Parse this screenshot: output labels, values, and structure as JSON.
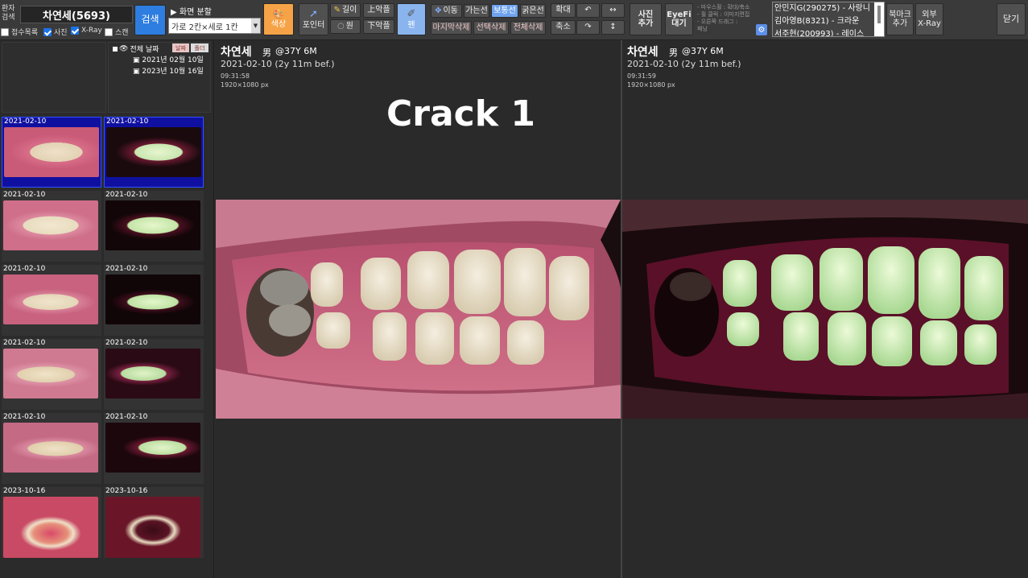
{
  "search": {
    "label": "환자\n검색",
    "patient": "차연세(5693)",
    "button": "검색"
  },
  "checkboxes": [
    {
      "label": "접수목록",
      "checked": false
    },
    {
      "label": "사진",
      "checked": true
    },
    {
      "label": "X-Ray",
      "checked": true
    },
    {
      "label": "스캔",
      "checked": false
    }
  ],
  "split": {
    "title": "▶ 화면 분할",
    "value": "가로 2칸×세로 1칸"
  },
  "toolbar": {
    "color": "색상",
    "pointer": "포인터",
    "length": "길이",
    "circle": "원",
    "upper": "上악플",
    "lower": "下악플",
    "pen": "펜",
    "move": "이동",
    "thin": "가는선",
    "medium": "보통선",
    "thick": "굵은선",
    "del_last": "마지막삭제",
    "del_sel": "선택삭제",
    "del_all": "전체삭제",
    "zoom_in": "확대",
    "zoom_out": "축소",
    "add_photo": "사진\n추가",
    "eyefi": "EyeFi\n대기",
    "hint1": "- 마우스휠 : 확대/축소",
    "hint2": "- 휠 클릭 : 이미지편집",
    "hint3": "- 오른쪽 드래그 :",
    "hint4": "  패닝",
    "bookmark": "북마크\n추가",
    "ext_xray": "외부\nX-Ray",
    "close": "닫기"
  },
  "bookmarks": [
    "안민지G(290275) - 사랑니",
    "김아영B(8321) - 크라운",
    "서주현(200993) - 레이스"
  ],
  "tree": {
    "root": "전체 날짜",
    "tab_date": "날짜",
    "tab_folder": "폴더",
    "items": [
      "2021년 02월 10일",
      "2023년 10월 16일"
    ]
  },
  "thumbs": [
    {
      "date": "2021-02-10"
    },
    {
      "date": "2021-02-10"
    },
    {
      "date": "2021-02-10"
    },
    {
      "date": "2021-02-10"
    },
    {
      "date": "2021-02-10"
    },
    {
      "date": "2021-02-10"
    },
    {
      "date": "2021-02-10"
    },
    {
      "date": "2021-02-10"
    },
    {
      "date": "2021-02-10"
    },
    {
      "date": "2021-02-10"
    },
    {
      "date": "2023-10-16"
    },
    {
      "date": "2023-10-16"
    }
  ],
  "viewer_left": {
    "name": "차연세",
    "sex": "男",
    "age": "@37Y 6M",
    "date": "2021-02-10 (2y 11m bef.)",
    "time": "09:31:58",
    "res": "1920×1080 px"
  },
  "viewer_right": {
    "name": "차연세",
    "sex": "男",
    "age": "@37Y 6M",
    "date": "2021-02-10 (2y 11m bef.)",
    "time": "09:31:59",
    "res": "1920×1080 px"
  },
  "overlay": "Crack 1"
}
